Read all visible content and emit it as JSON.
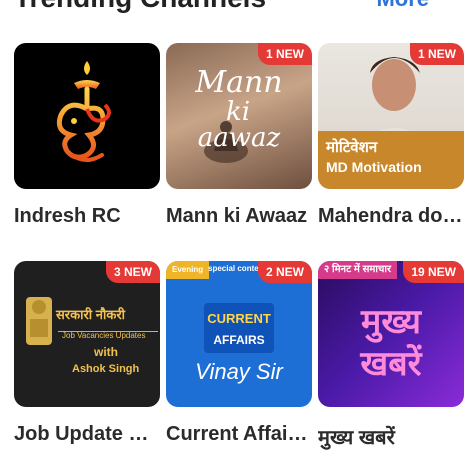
{
  "section": {
    "title": "Trending Channels",
    "more_label": "More"
  },
  "channels": [
    {
      "name": "Indresh RC",
      "badge": ""
    },
    {
      "name": "Mann ki Awaaz",
      "badge": "1 NEW",
      "art_text": [
        "Mann",
        "ki",
        "aawaz"
      ]
    },
    {
      "name": "Mahendra dogney",
      "badge": "1 NEW",
      "art_text": [
        "मोटिवेशन",
        "MD Motivation"
      ]
    },
    {
      "name": "Job Update with Ashok Singh",
      "badge": "3 NEW",
      "art_text": [
        "सरकारी नौकरी",
        "Job Vacancies Updates",
        "with",
        "Ashok Singh"
      ]
    },
    {
      "name": "Current Affairs Vinay Sir",
      "badge": "2 NEW",
      "art_text": [
        "Evening",
        "special content of GK",
        "CURRENT",
        "AFFAIRS",
        "Vinay Sir"
      ]
    },
    {
      "name": "मुख्य खबरें",
      "badge": "19 NEW",
      "art_text": [
        "२ मिनट में समाचार",
        "मुख्य",
        "खबरें"
      ]
    }
  ],
  "colors": {
    "badge": "#e53935",
    "link": "#2f72d8",
    "text": "#2b2b2b"
  },
  "icons": [
    "swastik-om-symbol-icon",
    "ashoka-emblem-icon",
    "person-silhouette-icon"
  ]
}
